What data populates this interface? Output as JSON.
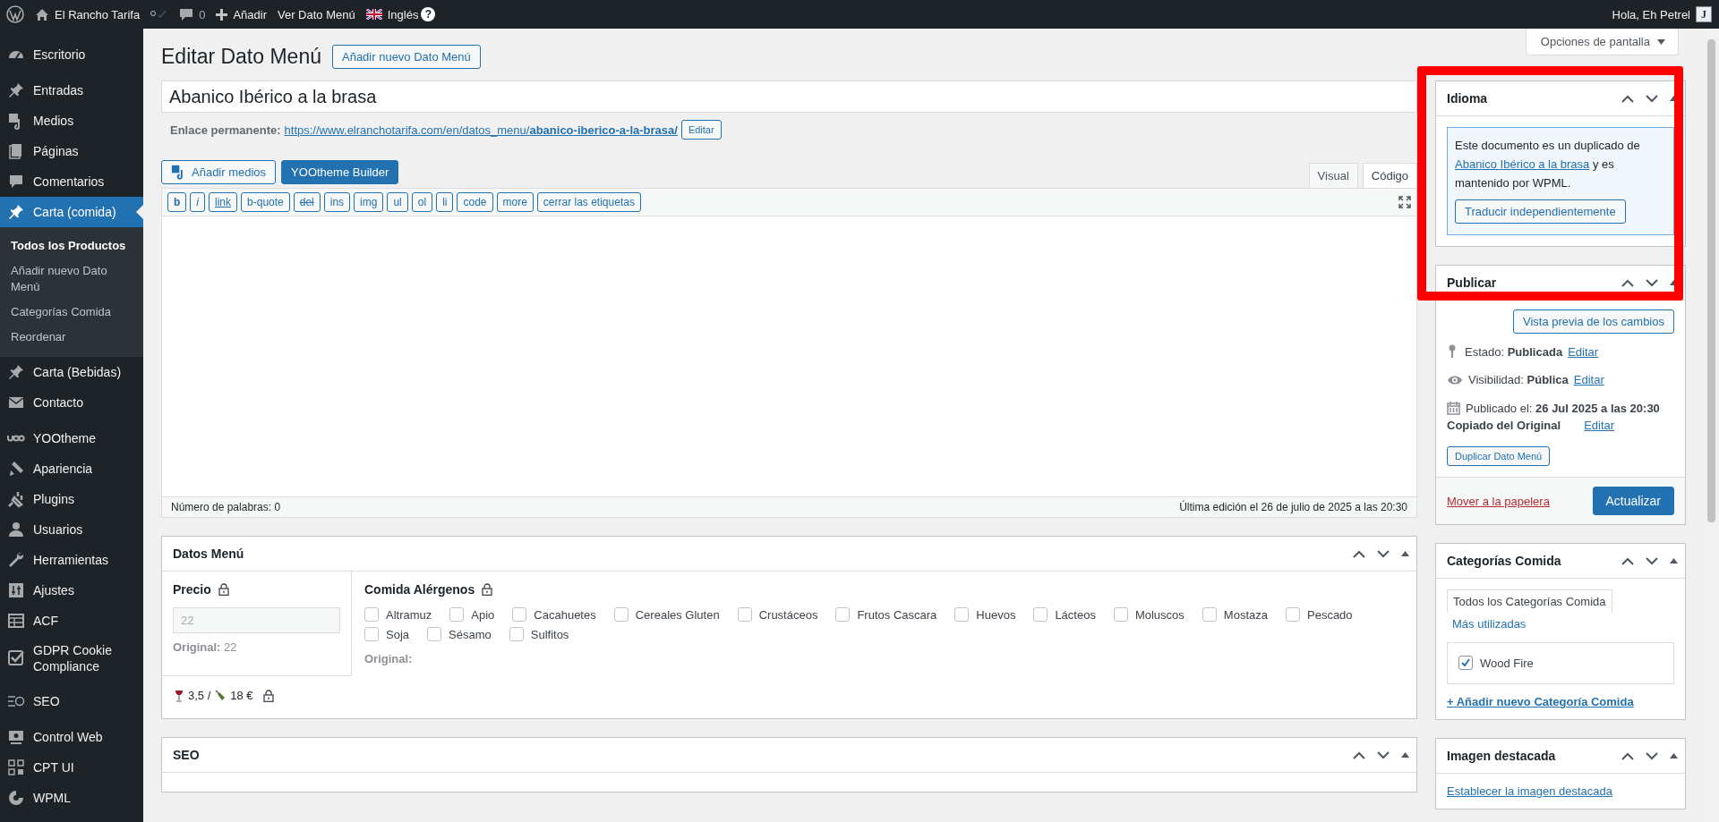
{
  "admin_bar": {
    "site_name": "El Rancho Tarifa",
    "comments_count": "0",
    "new_label": "Añadir",
    "view_label": "Ver Dato Menú",
    "language": "Inglés",
    "help_badge": "?",
    "greeting": "Hola, Eh Petrel",
    "avatar_letter": "J"
  },
  "sidebar": {
    "items": [
      {
        "label": "Escritorio",
        "selected": false
      },
      {
        "label": "Entradas",
        "selected": false
      },
      {
        "label": "Medios",
        "selected": false
      },
      {
        "label": "Páginas",
        "selected": false
      },
      {
        "label": "Comentarios",
        "selected": false
      },
      {
        "label": "Carta (comida)",
        "selected": true,
        "children": [
          {
            "label": "Todos los Productos",
            "selected": true
          },
          {
            "label": "Añadir nuevo Dato Menú",
            "selected": false
          },
          {
            "label": "Categorías Comida",
            "selected": false
          },
          {
            "label": "Reordenar",
            "selected": false
          }
        ]
      },
      {
        "label": "Carta (Bebidas)",
        "selected": false
      },
      {
        "label": "Contacto",
        "selected": false
      },
      {
        "label": "YOOtheme",
        "selected": false
      },
      {
        "label": "Apariencia",
        "selected": false
      },
      {
        "label": "Plugins",
        "selected": false
      },
      {
        "label": "Usuarios",
        "selected": false
      },
      {
        "label": "Herramientas",
        "selected": false
      },
      {
        "label": "Ajustes",
        "selected": false
      },
      {
        "label": "ACF",
        "selected": false
      },
      {
        "label": "GDPR Cookie Compliance",
        "selected": false
      },
      {
        "label": "SEO",
        "selected": false
      },
      {
        "label": "Control Web",
        "selected": false
      },
      {
        "label": "CPT UI",
        "selected": false
      },
      {
        "label": "WPML",
        "selected": false
      }
    ]
  },
  "screen_options": "Opciones de pantalla",
  "page_title": "Editar Dato Menú",
  "add_new_button": "Añadir nuevo Dato Menú",
  "title_field": {
    "value": "Abanico Ibérico a la brasa"
  },
  "permalink": {
    "label": "Enlace permanente:",
    "url": "https://www.elranchotarifa.com/en/datos_menu/**abanico-iberico-a-la-brasa/**",
    "edit_button": "Editar"
  },
  "editor": {
    "media_button": "Añadir medios",
    "builder_button": "YOOtheme Builder",
    "tabs": [
      {
        "label": "Visual",
        "selected": false
      },
      {
        "label": "Código",
        "selected": true
      }
    ],
    "quicktags": [
      {
        "label": "b",
        "kind": "bold"
      },
      {
        "label": "i",
        "kind": "italic"
      },
      {
        "label": "link",
        "kind": "underline"
      },
      {
        "label": "b-quote",
        "kind": "plain"
      },
      {
        "label": "del",
        "kind": "strike"
      },
      {
        "label": "ins",
        "kind": "plain"
      },
      {
        "label": "img",
        "kind": "plain"
      },
      {
        "label": "ul",
        "kind": "plain"
      },
      {
        "label": "ol",
        "kind": "plain"
      },
      {
        "label": "li",
        "kind": "plain"
      },
      {
        "label": "code",
        "kind": "plain"
      },
      {
        "label": "more",
        "kind": "plain"
      },
      {
        "label": "cerrar las etiquetas",
        "kind": "plain"
      }
    ],
    "word_count": "Número de palabras: 0",
    "last_edit": "Última edición el 26 de julio de 2025 a las 20:30"
  },
  "datos_menu": {
    "title": "Datos Menú",
    "price": {
      "label": "Precio",
      "value": "22",
      "disabled": true,
      "original": "**Original:** 22"
    },
    "allergens": {
      "label": "Comida Alérgenos",
      "options": [
        {
          "label": "Altramuz",
          "checked": false
        },
        {
          "label": "Apio",
          "checked": false
        },
        {
          "label": "Cacahuetes",
          "checked": false
        },
        {
          "label": "Cereales Gluten",
          "checked": false
        },
        {
          "label": "Crustáceos",
          "checked": false
        },
        {
          "label": "Frutos Cascara",
          "checked": false
        },
        {
          "label": "Huevos",
          "checked": false
        },
        {
          "label": "Lácteos",
          "checked": false
        },
        {
          "label": "Moluscos",
          "checked": false
        },
        {
          "label": "Mostaza",
          "checked": false
        },
        {
          "label": "Pescado",
          "checked": false
        },
        {
          "label": "Soja",
          "checked": false
        },
        {
          "label": "Sésamo",
          "checked": false
        },
        {
          "label": "Sulfitos",
          "checked": false
        }
      ],
      "original": "Original:"
    },
    "glass_price": "3,5 /",
    "bottle_price": "18 €"
  },
  "seo_box": {
    "title": "SEO"
  },
  "idioma": {
    "title": "Idioma",
    "notice_start": "Este documento es un duplicado de",
    "source_link": "Abanico Ibérico a la brasa",
    "notice_end": "y es mantenido por WPML.",
    "button": "Traducir independientemente"
  },
  "publish": {
    "title": "Publicar",
    "preview_button": "Vista previa de los cambios",
    "status": {
      "text": "Estado: **Publicada**",
      "edit": "Editar"
    },
    "visibility": {
      "text": "Visibilidad: **Pública**",
      "edit": "Editar"
    },
    "published": {
      "text": "Publicado el: **26 Jul 2025 a las 20:30**"
    },
    "copied": {
      "text": "Copiado del Original",
      "edit": "Editar"
    },
    "duplicate_button": "Duplicar Dato Menú",
    "trash_link": "Mover a la papelera",
    "update_button": "Actualizar"
  },
  "categories": {
    "title": "Categorías Comida",
    "tabs": [
      {
        "label": "Todos los Categorías Comida",
        "selected": true
      },
      {
        "label": "Más utilizadas",
        "selected": false
      }
    ],
    "items": [
      {
        "label": "Wood Fire",
        "checked": true
      }
    ],
    "add_link": "+ Añadir nuevo Categoría Comida"
  },
  "featured_image": {
    "title": "Imagen destacada",
    "set_link": "Establecer la imagen destacada"
  }
}
